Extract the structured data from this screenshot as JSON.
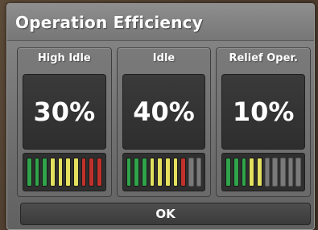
{
  "dialog": {
    "title": "Operation Efficiency",
    "ok_label": "OK"
  },
  "colors": {
    "green": "#2fa44a",
    "yellow": "#e3e05e",
    "red": "#c0312b",
    "off": "#7a7a7a"
  },
  "panels": [
    {
      "label": "High Idle",
      "value": "30%",
      "meter": [
        "green",
        "green",
        "green",
        "yellow",
        "yellow",
        "yellow",
        "yellow",
        "red",
        "red",
        "red"
      ]
    },
    {
      "label": "Idle",
      "value": "40%",
      "meter": [
        "green",
        "green",
        "green",
        "yellow",
        "yellow",
        "yellow",
        "yellow",
        "red",
        "off",
        "off"
      ]
    },
    {
      "label": "Relief Oper.",
      "value": "10%",
      "meter": [
        "green",
        "green",
        "green",
        "yellow",
        "yellow",
        "off",
        "off",
        "off",
        "off",
        "off"
      ]
    }
  ]
}
